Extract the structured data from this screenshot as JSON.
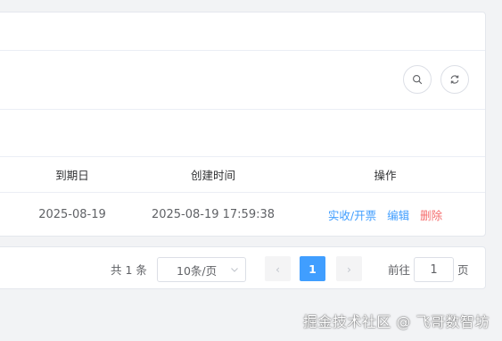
{
  "table": {
    "columns": {
      "due_date": "到期日",
      "created_at": "创建时间",
      "actions": "操作"
    },
    "rows": [
      {
        "due_date": "2025-08-19",
        "created_at": "2025-08-19 17:59:38",
        "actions": [
          "实收/开票",
          "编辑",
          "删除"
        ]
      }
    ]
  },
  "toolbar": {
    "buttons": [
      "search-icon",
      "refresh-icon"
    ]
  },
  "pagination": {
    "total": "共 1 条",
    "page_size": "10条/页",
    "prev": "‹",
    "current_page": "1",
    "next": "›",
    "goto_prefix": "前往",
    "goto_value": "1",
    "goto_suffix": "页"
  },
  "colors": {
    "primary": "#409eff",
    "danger": "#f56c6c"
  },
  "watermark": "掘金技术社区 @ 飞哥数智坊"
}
